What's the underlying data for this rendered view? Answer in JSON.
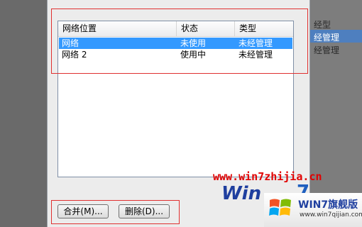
{
  "background_window": {
    "line1": "经型",
    "line2": "经管理",
    "line3": "经管理"
  },
  "list": {
    "columns": [
      "网络位置",
      "状态",
      "类型"
    ],
    "rows": [
      {
        "name": "网络",
        "status": "未使用",
        "type": "未经管理",
        "selected": true
      },
      {
        "name": "网络  2",
        "status": "使用中",
        "type": "未经管理",
        "selected": false
      }
    ]
  },
  "buttons": {
    "merge": "合并(M)...",
    "delete": "删除(D)..."
  },
  "watermark": {
    "url": "www.win7zhijia.cn",
    "logo_text": "Win",
    "logo_digit": "7",
    "badge_title": "WIN7旗舰版",
    "badge_site": "www.win7qijian.com"
  }
}
